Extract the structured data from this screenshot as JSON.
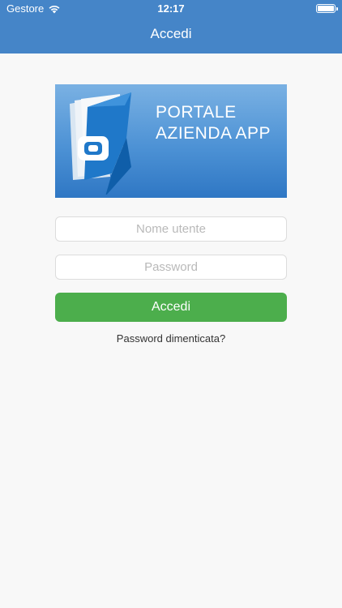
{
  "status_bar": {
    "carrier": "Gestore",
    "time": "12:17",
    "wifi_icon": "wifi-icon",
    "battery_icon": "battery-icon",
    "battery_level": 1.0
  },
  "nav": {
    "title": "Accedi"
  },
  "banner": {
    "line1": "PORTALE",
    "line2": "AZIENDA APP",
    "logo_icon": "portale-azienda-logo"
  },
  "form": {
    "username_placeholder": "Nome utente",
    "username_value": "",
    "password_placeholder": "Password",
    "password_value": "",
    "submit_label": "Accedi",
    "forgot_label": "Password dimenticata?"
  },
  "colors": {
    "header": "#4585c8",
    "button": "#4cae4c",
    "background": "#f8f8f8"
  }
}
